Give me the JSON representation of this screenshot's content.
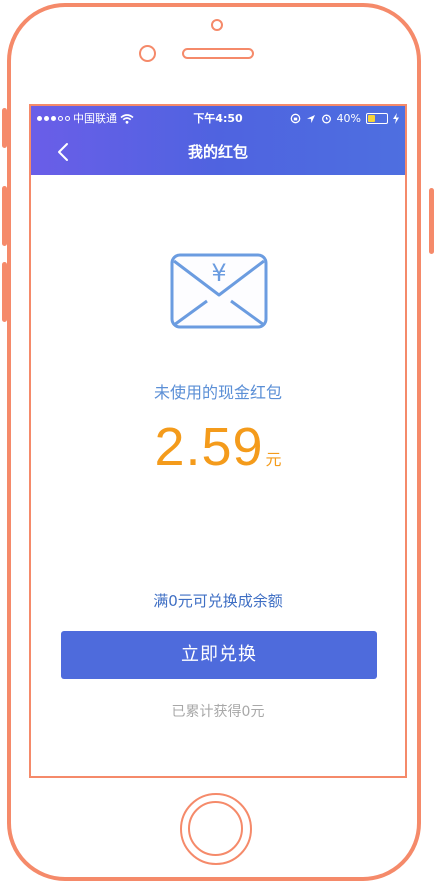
{
  "status_bar": {
    "carrier": "中国联通",
    "time": "下午4:50",
    "battery": "40%",
    "battery_level": 0.4
  },
  "nav": {
    "title": "我的红包"
  },
  "envelope": {
    "symbol": "¥"
  },
  "redpacket": {
    "label": "未使用的现金红包",
    "amount": "2.59",
    "unit": "元",
    "threshold_text": "满0元可兑换成余额",
    "exchange_button": "立即兑换",
    "total_earned": "已累计获得0元"
  },
  "colors": {
    "frame": "#f58a6a",
    "header_gradient_start": "#6a5ee8",
    "header_gradient_end": "#4e6fe0",
    "accent_blue": "#4e6bdc",
    "amount_orange": "#f49b1b",
    "label_blue": "#5b8fd6",
    "muted_gray": "#a8a8a8"
  }
}
